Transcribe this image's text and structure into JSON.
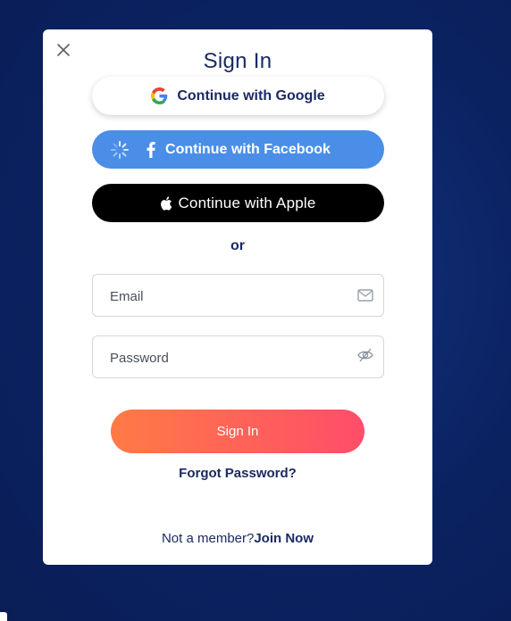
{
  "modal": {
    "title": "Sign In",
    "google_label": "Continue with Google",
    "facebook_label": "Continue with Facebook",
    "apple_label": "Continue with Apple",
    "or_label": "or",
    "email_placeholder": "Email",
    "password_placeholder": "Password",
    "signin_label": "Sign In",
    "forgot_label": "Forgot Password?",
    "footer_text": "Not a member?",
    "join_label": "Join Now"
  },
  "colors": {
    "background": "#0b2060",
    "facebook": "#4a8ee8",
    "apple": "#000000",
    "primary_gradient_start": "#ff7a45",
    "primary_gradient_end": "#ff4d6a",
    "text_dark": "#1a2a63"
  },
  "icons": {
    "close": "close-icon",
    "google": "google-icon",
    "facebook": "facebook-icon",
    "apple": "apple-icon",
    "loading": "spinner-icon",
    "email": "mail-icon",
    "password": "eye-off-icon"
  }
}
